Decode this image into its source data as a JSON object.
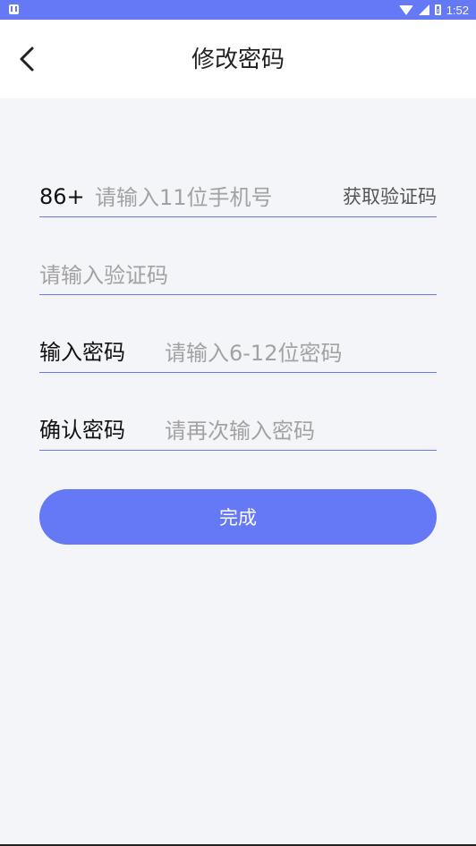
{
  "status_bar": {
    "time": "1:52"
  },
  "header": {
    "title": "修改密码"
  },
  "form": {
    "country_code": "86+",
    "phone_placeholder": "请输入11位手机号",
    "get_code_label": "获取验证码",
    "code_placeholder": "请输入验证码",
    "password_label": "输入密码",
    "password_placeholder": "请输入6-12位密码",
    "confirm_label": "确认密码",
    "confirm_placeholder": "请再次输入密码",
    "submit_label": "完成"
  },
  "colors": {
    "accent": "#6578f6",
    "background": "#f4f5f8"
  }
}
